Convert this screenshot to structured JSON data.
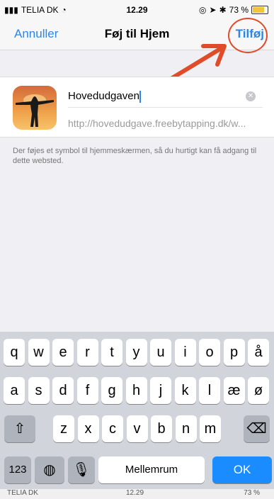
{
  "status_bar": {
    "carrier": "TELIA DK",
    "time": "12.29",
    "battery": "73 %",
    "battery_level": 0.73
  },
  "nav": {
    "cancel_label": "Annuller",
    "title": "Føj til Hjem",
    "add_label": "Tilføj"
  },
  "bookmark": {
    "title_value": "Hovedudgaven",
    "url": "http://hovedudgave.freebytapping.dk/w..."
  },
  "info_text": "Der føjes et symbol til hjemmeskærmen, så du hurtigt kan få adgang til dette websted.",
  "keyboard": {
    "row1": [
      "q",
      "w",
      "e",
      "r",
      "t",
      "y",
      "u",
      "i",
      "o",
      "p",
      "å"
    ],
    "row2": [
      "a",
      "s",
      "d",
      "f",
      "g",
      "h",
      "j",
      "k",
      "l",
      "æ",
      "ø"
    ],
    "row3": [
      "z",
      "x",
      "c",
      "v",
      "b",
      "n",
      "m"
    ],
    "numbers_label": "123",
    "space_label": "Mellemrum",
    "ok_label": "OK"
  },
  "bottom_status": {
    "carrier": "TELIA DK",
    "time": "12.29",
    "battery": "73 %"
  },
  "colors": {
    "accent": "#2b86e8",
    "annotation": "#e04b2a",
    "ok_key": "#1a8cff"
  }
}
